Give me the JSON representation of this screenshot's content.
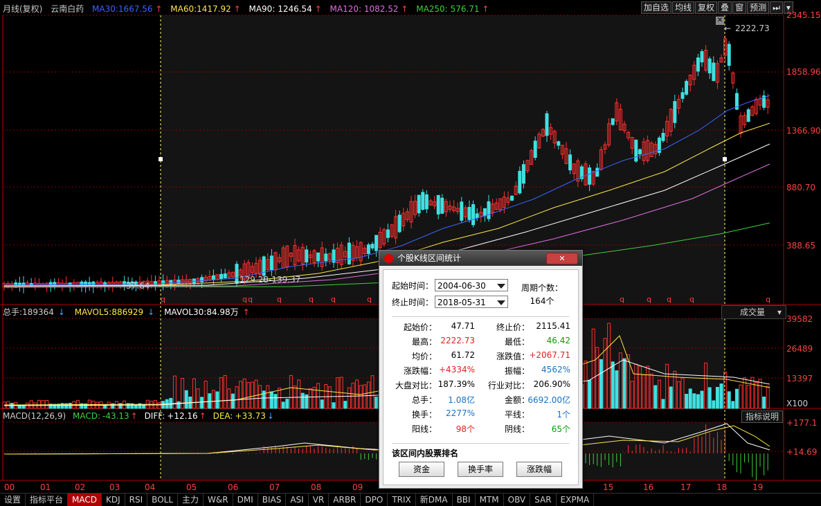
{
  "header": {
    "title": "月线(复权)",
    "stock": "云南白药",
    "ma": [
      {
        "label": "MA30:",
        "value": "1667.56",
        "color": "#3a64ff"
      },
      {
        "label": "MA60:",
        "value": "1417.92",
        "color": "#ffe84a"
      },
      {
        "label": "MA90:",
        "value": "1246.54",
        "color": "#ffffff"
      },
      {
        "label": "MA120:",
        "value": "1082.52",
        "color": "#e070e0"
      },
      {
        "label": "MA250:",
        "value": "576.71",
        "color": "#40d040"
      }
    ]
  },
  "toolbar": {
    "add_self": "加自选",
    "ma_line": "均线",
    "fq": "复权",
    "overlay": "叠",
    "window": "窗",
    "predict": "预测"
  },
  "price_axis": [
    "2345.15",
    "1858.96",
    "1366.90",
    "880.70",
    "388.65"
  ],
  "annotations": {
    "high": "2222.73",
    "low1": "37.64",
    "mid": "129.28-139.37",
    "gap_mark": "q"
  },
  "volume": {
    "title": "总手:",
    "value": "189364",
    "mavol5_label": "MAVOL5:",
    "mavol5": "886929",
    "mavol30_label": "MAVOL30:",
    "mavol30": "84.98万",
    "axis": [
      "39582",
      "26489",
      "13397",
      "X100"
    ],
    "selector": "成交量"
  },
  "macd": {
    "title": "MACD(12,26,9)",
    "macd_label": "MACD:",
    "macd": "-43.13",
    "diff_label": "DIFF:",
    "diff": "+12.16",
    "dea_label": "DEA:",
    "dea": "+33.73",
    "axis": [
      "+177.1",
      "+14.69"
    ],
    "explain": "指标说明"
  },
  "x_axis": [
    "00",
    "01",
    "02",
    "03",
    "04",
    "05",
    "06",
    "07",
    "08",
    "09",
    "15",
    "16",
    "17",
    "18",
    "19"
  ],
  "tabs": [
    "设置",
    "指标平台",
    "MACD",
    "KDJ",
    "RSI",
    "BOLL",
    "主力",
    "W&R",
    "DMI",
    "BIAS",
    "ASI",
    "VR",
    "ARBR",
    "DPO",
    "TRIX",
    "新DMA",
    "BBI",
    "MTM",
    "OBV",
    "SAR",
    "EXPMA"
  ],
  "active_tab": "MACD",
  "dialog": {
    "title": "个股K线区间统计",
    "start_label": "起始时间：",
    "start": "2004-06-30",
    "end_label": "终止时间：",
    "end": "2018-05-31",
    "period_label": "周期个数：",
    "period": "164个",
    "rows": [
      {
        "k1": "起始价：",
        "v1": "47.71",
        "c1": "",
        "k2": "终止价：",
        "v2": "2115.41",
        "c2": ""
      },
      {
        "k1": "最高：",
        "v1": "2222.73",
        "c1": "red",
        "k2": "最低：",
        "v2": "46.42",
        "c2": "green"
      },
      {
        "k1": "均价：",
        "v1": "61.72",
        "c1": "",
        "k2": "涨跌值：",
        "v2": "+2067.71",
        "c2": "red"
      },
      {
        "k1": "涨跌幅：",
        "v1": "+4334%",
        "c1": "red",
        "k2": "振幅：",
        "v2": "4562%",
        "c2": "blue"
      },
      {
        "k1": "大盘对比：",
        "v1": "187.39%",
        "c1": "",
        "k2": "行业对比：",
        "v2": "206.90%",
        "c2": ""
      },
      {
        "k1": "总手：",
        "v1": "1.08亿",
        "c1": "blue",
        "k2": "金额：",
        "v2": "6692.00亿",
        "c2": "blue"
      },
      {
        "k1": "换手：",
        "v1": "2277%",
        "c1": "blue",
        "k2": "平线：",
        "v2": "1个",
        "c2": "blue"
      },
      {
        "k1": "阳线：",
        "v1": "98个",
        "c1": "red",
        "k2": "阴线：",
        "v2": "65个",
        "c2": "green"
      }
    ],
    "rank_label": "该区间内股票排名",
    "btn_fund": "资金",
    "btn_turnover": "换手率",
    "btn_change": "涨跌幅"
  }
}
